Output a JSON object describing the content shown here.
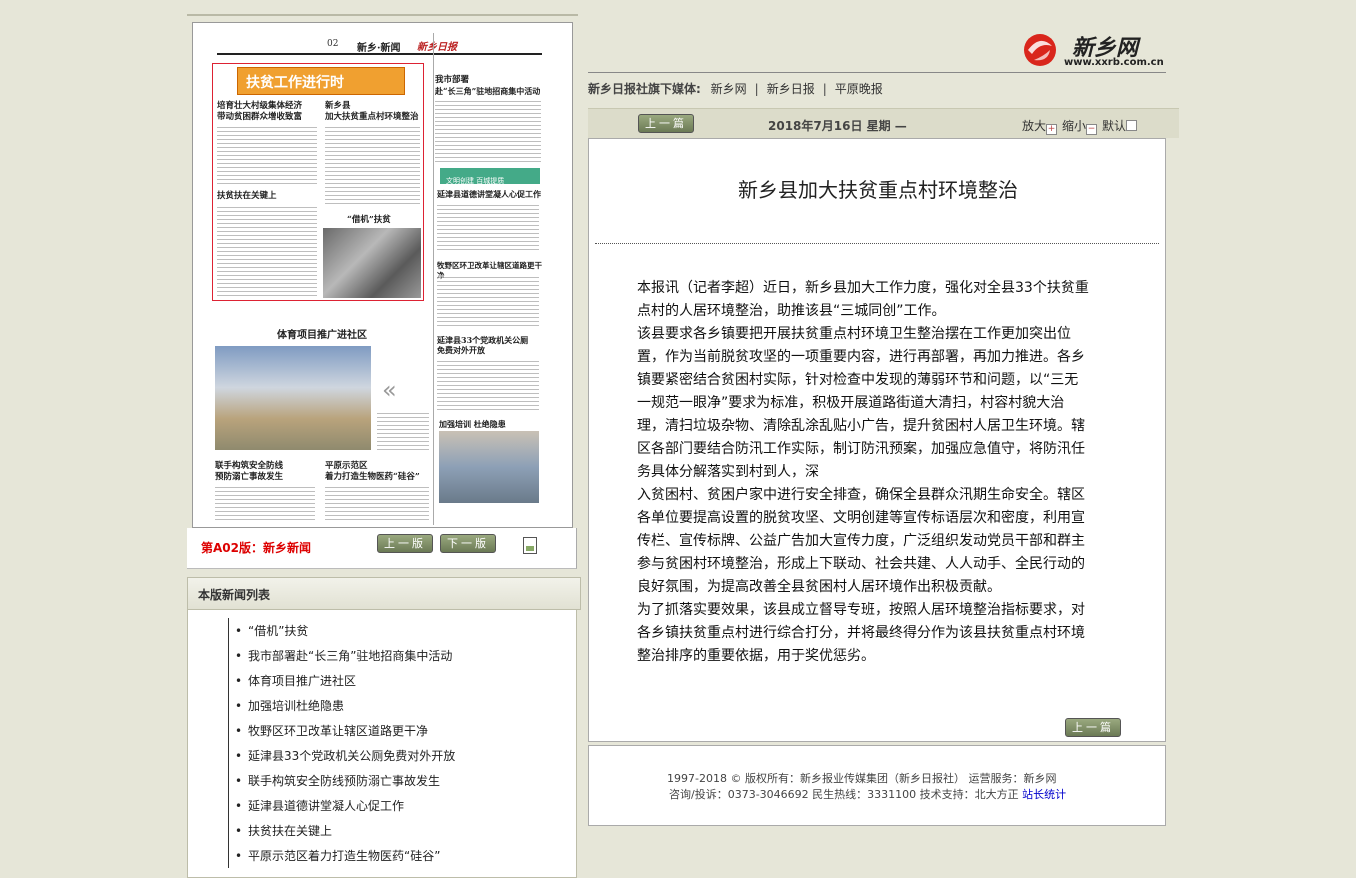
{
  "site": {
    "name": "新乡网",
    "url": "www.xxrb.com.cn"
  },
  "media": {
    "label": "新乡日报社旗下媒体:",
    "links": [
      "新乡网",
      "新乡日报",
      "平原晚报"
    ]
  },
  "toolbar": {
    "prev_label": "上一篇",
    "date": "2018年7月16日 星期 —",
    "zoom_in": "放大",
    "zoom_out": "缩小",
    "reset": "默认"
  },
  "article": {
    "title": "新乡县加大扶贫重点村环境整治",
    "paragraphs": [
      "本报讯（记者李超）近日，新乡县加大工作力度，强化对全县33个扶贫重点村的人居环境整治，助推该县“三城同创”工作。",
      "该县要求各乡镇要把开展扶贫重点村环境卫生整治摆在工作更加突出位置，作为当前脱贫攻坚的一项重要内容，进行再部署，再加力推进。各乡镇要紧密结合贫困村实际，针对检查中发现的薄弱环节和问题，以“三无一规范一眼净”要求为标准，积极开展道路街道大清扫，村容村貌大治理，清扫垃圾杂物、清除乱涂乱贴小广告，提升贫困村人居卫生环境。辖区各部门要结合防汛工作实际，制订防汛预案，加强应急值守，将防汛任务具体分解落实到村到人，深",
      "入贫困村、贫困户家中进行安全排查，确保全县群众汛期生命安全。辖区各单位要提高设置的脱贫攻坚、文明创建等宣传标语层次和密度，利用宣传栏、宣传标牌、公益广告加大宣传力度，广泛组织发动党员干部和群主参与贫困村环境整治，形成上下联动、社会共建、人人动手、全民行动的良好氛围，为提高改善全县贫困村人居环境作出积极贡献。",
      "为了抓落实要效果，该县成立督导专班，按照人居环境整治指标要求，对各乡镇扶贫重点村进行综合打分，并将最终得分作为该县扶贫重点村环境整治排序的重要依据，用于奖优惩劣。"
    ],
    "bottom_prev": "上一篇"
  },
  "footer": {
    "line1": "1997-2018 © 版权所有：新乡报业传媒集团（新乡日报社） 运营服务：新乡网",
    "line2": "咨询/投诉：0373-3046692 民生热线：3331100 技术支持：北大方正",
    "stats": "站长统计"
  },
  "edition": {
    "label": "第A02版：新乡新闻",
    "prev": "上一版",
    "next": "下一版"
  },
  "newspaper": {
    "page_no": "02",
    "section": "新乡·新闻",
    "logo": "新乡日报",
    "banner": "扶贫工作进行时",
    "green_banner": "文明创建 百城提质",
    "headlines": [
      "培育壮大村级集体经济",
      "带动贫困群众增收致富",
      "新乡县",
      "加大扶贫重点村环境整治",
      "扶贫扶在关键上",
      "“借机”扶贫",
      "体育项目推广进社区",
      "联手构筑安全防线",
      "预防溺亡事故发生",
      "平原示范区",
      "着力打造生物医药“硅谷”",
      "我市部署",
      "赴“长三角”驻地招商集中活动",
      "延津县道德讲堂凝人心促工作",
      "牧野区环卫改革让辖区道路更干净",
      "延津县33个党政机关公厕",
      "免费对外开放",
      "加强培训 杜绝隐患"
    ]
  },
  "list": {
    "title": "本版新闻列表",
    "items": [
      "“借机”扶贫",
      "我市部署赴“长三角”驻地招商集中活动",
      "体育项目推广进社区",
      "加强培训杜绝隐患",
      "牧野区环卫改革让辖区道路更干净",
      "延津县33个党政机关公厕免费对外开放",
      "联手构筑安全防线预防溺亡事故发生",
      "延津县道德讲堂凝人心促工作",
      "扶贫扶在关键上",
      "平原示范区着力打造生物医药“硅谷”"
    ]
  }
}
